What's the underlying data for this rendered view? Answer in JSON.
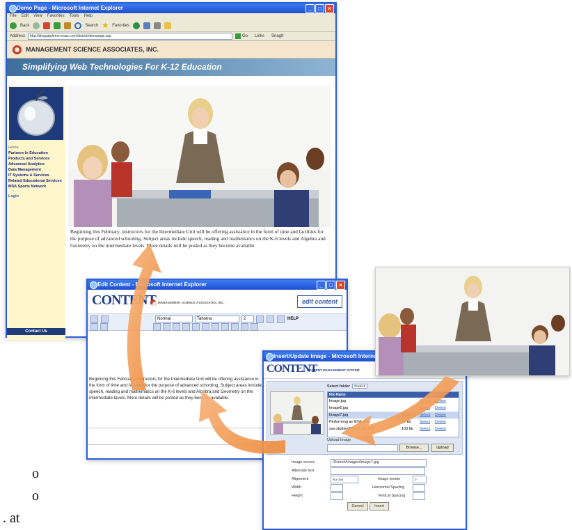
{
  "main_window": {
    "title": "Demo Page - Microsoft Internet Explorer",
    "menu": [
      "File",
      "Edit",
      "View",
      "Favorites",
      "Tools",
      "Help"
    ],
    "toolbar": {
      "back": "Back",
      "search": "Search",
      "favorites": "Favorites"
    },
    "address_label": "Address",
    "address_value": "http://disquabdemo.msac.com/district/demopage.asp",
    "go_label": "Go",
    "links_label": "Links",
    "snagit_label": "SnagIt"
  },
  "site": {
    "logo_text": "MANAGEMENT SCIENCE ASSOCIATES, INC.",
    "slogan": "Simplifying Web Technologies For K-12 Education",
    "nav": {
      "home": "Home",
      "items": [
        "Partners In Education",
        "Products and Services",
        "Advanced Analytics",
        "Data Management",
        "IT Systems & Services",
        "Related Educational Services",
        "MSA Sports Network"
      ],
      "login": "Login"
    },
    "contact": "Contact Us",
    "body_text": "Beginning this February, instructors for the Intermediate Unit will be offering assistance in the form of time and facilities for the purpose of advanced schooling. Subject areas include speech, reading and mathematics on the K-6 levels and Algebra and Geometry on the intermediate levels. More details will be posted as they become available."
  },
  "editor_window": {
    "title": "Edit Content - Microsoft Internet Explorer",
    "logo": "CONTENT",
    "edit_badge": "edit content",
    "style_select": "Normal",
    "font_select": "Tahoma",
    "size_select": "2",
    "help_label": "HELP",
    "small_logo_text": "MANAGEMENT SCIENCE ASSOCIATES, INC.",
    "body_text": "Beginning this February, instructors for the Intermediate Unit will be offering assistance in the form of time and facilities for the purpose of advanced schooling. Subject areas include speech, reading and mathematics on the K-6 levels and Algebra and Geometry on the intermediate levels. More details will be posted as they become available."
  },
  "image_dialog": {
    "title": "Insert/Update Image - Microsoft Internet Explorer",
    "logo": "CONTENT",
    "logo_sub": "CONTENT MANAGEMENT SYSTEM",
    "select_folder_label": "Select folder",
    "folder_value": "/District/",
    "file_header": "File Name",
    "files": [
      {
        "name": "Image.jpg",
        "size": "",
        "sel": false
      },
      {
        "name": "Image6.jpg",
        "size": "",
        "sel": false
      },
      {
        "name": "Image7.jpg",
        "size": "31 kb",
        "sel": true
      },
      {
        "name": "Performing an EVA.JPG",
        "size": "47 kb",
        "sel": false
      },
      {
        "name": "sss-studies/DSC0158.JPG",
        "size": "103 kb",
        "sel": false
      }
    ],
    "file_actions": [
      "Select",
      "Delete"
    ],
    "upload_label": "Upload Image",
    "browse_label": "Browse...",
    "upload_button": "Upload",
    "image_source_label": "Image source",
    "image_source_value": "/District/Images/Image7.jpg",
    "alt_label": "Alternate text",
    "alignment_label": "Alignment",
    "alignment_value": "Not Set",
    "border_label": "Image border",
    "border_value": "0",
    "width_label": "Width",
    "hspace_label": "Horizontal Spacing",
    "height_label": "Height",
    "vspace_label": "Vertical Spacing",
    "cancel_label": "Cancel",
    "insert_label": "Insert"
  },
  "margin_text": [
    "o",
    "o",
    ". at"
  ],
  "colors": {
    "xp_blue": "#2b5fd6",
    "arrow_orange": "#f2994a",
    "sidebar_bg": "#fff6cc",
    "slogan_blue": "#3e6f9c"
  },
  "icons": [
    "ie-icon",
    "back-icon",
    "forward-icon",
    "stop-icon",
    "refresh-icon",
    "home-icon",
    "search-icon",
    "favorites-icon",
    "media-icon",
    "mail-icon",
    "print-icon",
    "folder-icon",
    "apple-logo",
    "msa-logo-icon"
  ]
}
